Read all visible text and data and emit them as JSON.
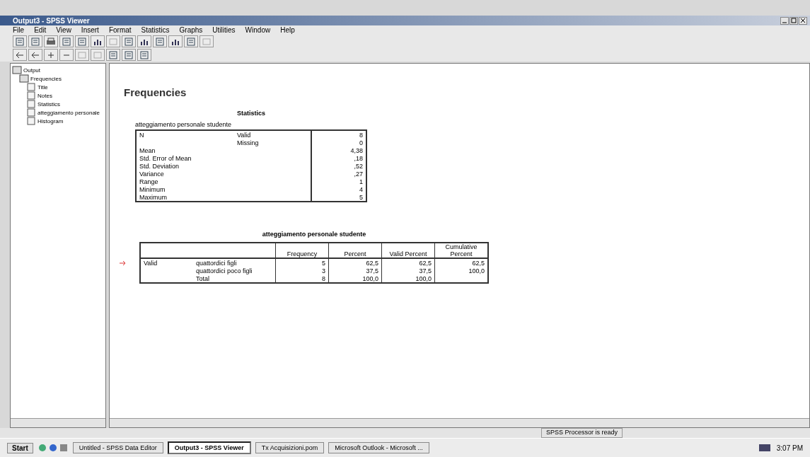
{
  "window": {
    "title": "Output3 - SPSS Viewer"
  },
  "menu": [
    "File",
    "Edit",
    "View",
    "Insert",
    "Format",
    "Statistics",
    "Graphs",
    "Utilities",
    "Window",
    "Help"
  ],
  "outline": [
    {
      "label": "Output",
      "expanded": true,
      "children": [
        {
          "label": "Frequencies",
          "expanded": true,
          "children": [
            {
              "label": "Title"
            },
            {
              "label": "Notes"
            },
            {
              "label": "Statistics"
            },
            {
              "label": "atteggiamento personale"
            },
            {
              "label": "Histogram"
            }
          ]
        }
      ]
    }
  ],
  "content": {
    "heading": "Frequencies",
    "stats_table": {
      "title": "Statistics",
      "variable": "atteggiamento personale studente",
      "rows": [
        [
          "N",
          "Valid",
          "8"
        ],
        [
          "",
          "Missing",
          "0"
        ],
        [
          "Mean",
          "",
          "4,38"
        ],
        [
          "Std. Error of Mean",
          "",
          ",18"
        ],
        [
          "Std. Deviation",
          "",
          ",52"
        ],
        [
          "Variance",
          "",
          ",27"
        ],
        [
          "Range",
          "",
          "1"
        ],
        [
          "Minimum",
          "",
          "4"
        ],
        [
          "Maximum",
          "",
          "5"
        ]
      ]
    },
    "freq_table": {
      "title": "atteggiamento personale studente",
      "columns": [
        "",
        "",
        "Frequency",
        "Percent",
        "Valid Percent",
        "Cumulative Percent"
      ],
      "rows": [
        [
          "Valid",
          "quattordici figli",
          "5",
          "62,5",
          "62,5",
          "62,5"
        ],
        [
          "",
          "quattordici poco figli",
          "3",
          "37,5",
          "37,5",
          "100,0"
        ],
        [
          "",
          "Total",
          "8",
          "100,0",
          "100,0",
          ""
        ]
      ]
    }
  },
  "status_bar": {
    "message": "SPSS Processor is ready"
  },
  "taskbar": {
    "start": "Start",
    "tasks": [
      {
        "label": "Untitled - SPSS Data Editor",
        "selected": false
      },
      {
        "label": "Output3 - SPSS Viewer",
        "selected": true
      },
      {
        "label": "Tx Acquisizioni.pom",
        "selected": false
      },
      {
        "label": "Microsoft Outlook - Microsoft ...",
        "selected": false
      }
    ],
    "clock": "3:07 PM"
  }
}
